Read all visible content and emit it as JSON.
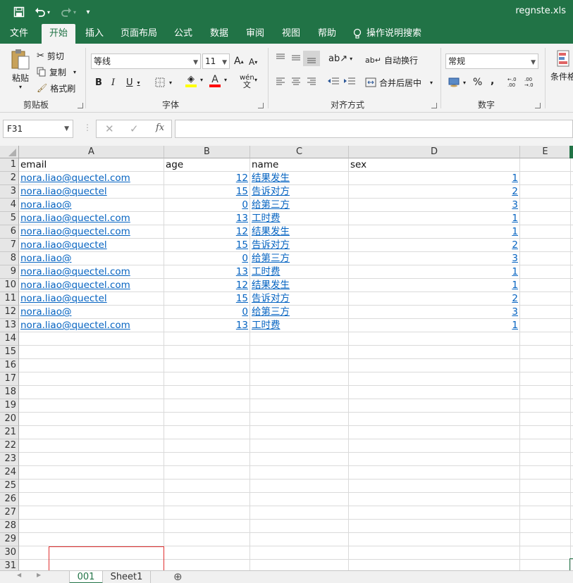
{
  "app": {
    "filename": "regnste.xls",
    "accent_color": "#217346",
    "link_color": "#0563c1"
  },
  "quick_access": {
    "save_icon": "save-icon",
    "undo_icon": "undo-icon",
    "redo_icon": "redo-icon",
    "customize_icon": "customize-icon"
  },
  "menu": {
    "tabs": [
      "文件",
      "开始",
      "插入",
      "页面布局",
      "公式",
      "数据",
      "审阅",
      "视图",
      "帮助"
    ],
    "active": "开始",
    "tell_me": "操作说明搜索"
  },
  "ribbon": {
    "clipboard": {
      "label": "剪贴板",
      "paste": "粘贴",
      "cut": "剪切",
      "copy": "复制",
      "format_painter": "格式刷"
    },
    "font": {
      "label": "字体",
      "font_name": "等线",
      "font_size": "11",
      "bold": "B",
      "italic": "I",
      "underline": "U",
      "grow": "A",
      "shrink": "A",
      "font_color": "A",
      "phonetic": "wén"
    },
    "alignment": {
      "label": "对齐方式",
      "wrap_text": "自动换行",
      "merge_center": "合并后居中"
    },
    "number": {
      "label": "数字",
      "format": "常规",
      "percent": "%",
      "comma": ",",
      "inc_decimal": "←.0 .00",
      "dec_decimal": ".00 →.0"
    },
    "styles": {
      "conditional": "条件格"
    }
  },
  "formula_bar": {
    "name_box": "F31",
    "fx": "fx",
    "cancel": "✕",
    "enter": "✓",
    "formula": ""
  },
  "sheet": {
    "columns": [
      "A",
      "B",
      "C",
      "D",
      "E"
    ],
    "rows": [
      "1",
      "2",
      "3",
      "4",
      "5",
      "6",
      "7",
      "8",
      "9",
      "10",
      "11",
      "12",
      "13",
      "14",
      "15",
      "16",
      "17",
      "18",
      "19",
      "20",
      "21",
      "22",
      "23",
      "24",
      "25",
      "26",
      "27",
      "28",
      "29",
      "30",
      "31"
    ],
    "header": [
      "email",
      "age",
      "name",
      "sex"
    ],
    "data": [
      [
        "nora.liao@quectel.com",
        "12",
        "结果发生",
        "1"
      ],
      [
        "nora.liao@quectel",
        "15",
        "告诉对方",
        "2"
      ],
      [
        "nora.liao@",
        "0",
        "给第三方",
        "3"
      ],
      [
        "nora.liao@quectel.com",
        "13",
        "工时费",
        "1"
      ],
      [
        "nora.liao@quectel.com",
        "12",
        "结果发生",
        "1"
      ],
      [
        "nora.liao@quectel",
        "15",
        "告诉对方",
        "2"
      ],
      [
        "nora.liao@",
        "0",
        "给第三方",
        "3"
      ],
      [
        "nora.liao@quectel.com",
        "13",
        "工时费",
        "1"
      ],
      [
        "nora.liao@quectel.com",
        "12",
        "结果发生",
        "1"
      ],
      [
        "nora.liao@quectel",
        "15",
        "告诉对方",
        "2"
      ],
      [
        "nora.liao@",
        "0",
        "给第三方",
        "3"
      ],
      [
        "nora.liao@quectel.com",
        "13",
        "工时费",
        "1"
      ]
    ]
  },
  "sheet_tabs": {
    "tabs": [
      "001",
      "Sheet1"
    ],
    "active": "001",
    "add": "⊕"
  }
}
